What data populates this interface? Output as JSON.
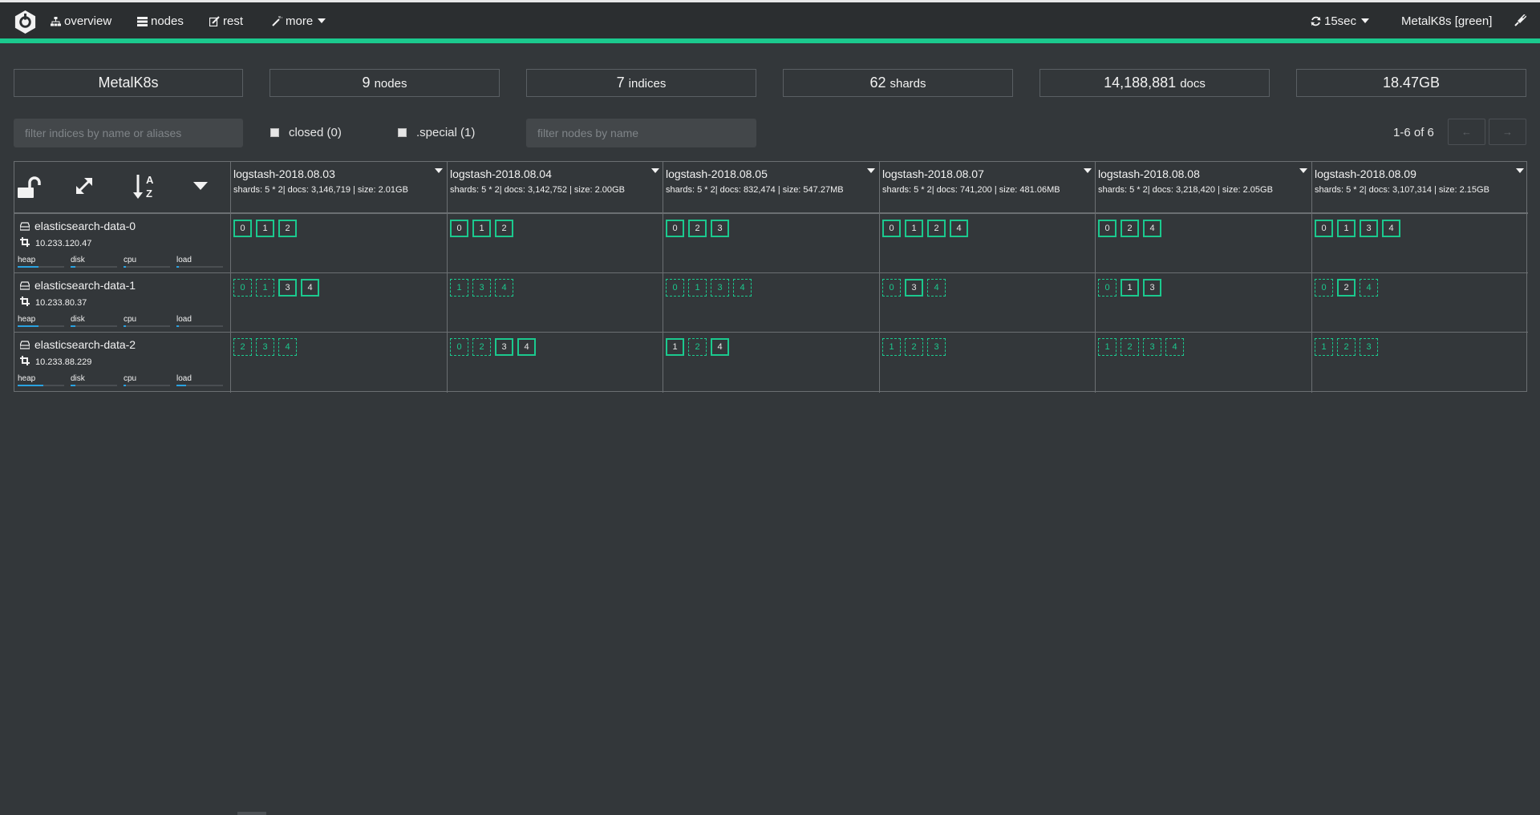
{
  "nav": {
    "overview": "overview",
    "nodes": "nodes",
    "rest": "rest",
    "more": "more",
    "refresh": "15sec",
    "cluster_status": "MetalK8s [green]"
  },
  "colors": {
    "accent": "#1bc98e",
    "metric_bar": "#2aa2e0",
    "background": "#33373a"
  },
  "summary": {
    "cluster_name": "MetalK8s",
    "nodes_count": "9",
    "nodes_unit": "nodes",
    "indices_count": "7",
    "indices_unit": "indices",
    "shards_count": "62",
    "shards_unit": "shards",
    "docs_count": "14,188,881",
    "docs_unit": "docs",
    "size": "18.47GB"
  },
  "filters": {
    "indices_placeholder": "filter indices by name or aliases",
    "closed_label": "closed (0)",
    "special_label": ".special (1)",
    "nodes_placeholder": "filter nodes by name",
    "pagination": "1-6 of 6",
    "prev_label": "←",
    "next_label": "→"
  },
  "toolbar_icons": [
    "unlock-icon",
    "expand-icon",
    "sort-alpha-icon",
    "caret-down-icon"
  ],
  "indices": [
    {
      "name": "logstash-2018.08.03",
      "meta": "shards: 5 * 2| docs: 3,146,719 | size: 2.01GB"
    },
    {
      "name": "logstash-2018.08.04",
      "meta": "shards: 5 * 2| docs: 3,142,752 | size: 2.00GB"
    },
    {
      "name": "logstash-2018.08.05",
      "meta": "shards: 5 * 2| docs: 832,474 | size: 547.27MB"
    },
    {
      "name": "logstash-2018.08.07",
      "meta": "shards: 5 * 2| docs: 741,200 | size: 481.06MB"
    },
    {
      "name": "logstash-2018.08.08",
      "meta": "shards: 5 * 2| docs: 3,218,420 | size: 2.05GB"
    },
    {
      "name": "logstash-2018.08.09",
      "meta": "shards: 5 * 2| docs: 3,107,314 | size: 2.15GB"
    }
  ],
  "nodes": [
    {
      "name": "elasticsearch-data-0",
      "ip": "10.233.120.47",
      "metrics": {
        "heap": "heap",
        "disk": "disk",
        "cpu": "cpu",
        "load": "load"
      },
      "levels": {
        "heap": 0.45,
        "disk": 0.1,
        "cpu": 0.06,
        "load": 0.06
      },
      "shards": [
        [
          {
            "n": "0",
            "p": true
          },
          {
            "n": "1",
            "p": true
          },
          {
            "n": "2",
            "p": true
          }
        ],
        [
          {
            "n": "0",
            "p": true
          },
          {
            "n": "1",
            "p": true
          },
          {
            "n": "2",
            "p": true
          }
        ],
        [
          {
            "n": "0",
            "p": true
          },
          {
            "n": "2",
            "p": true
          },
          {
            "n": "3",
            "p": true
          }
        ],
        [
          {
            "n": "0",
            "p": true
          },
          {
            "n": "1",
            "p": true
          },
          {
            "n": "2",
            "p": true
          },
          {
            "n": "4",
            "p": true
          }
        ],
        [
          {
            "n": "0",
            "p": true
          },
          {
            "n": "2",
            "p": true
          },
          {
            "n": "4",
            "p": true
          }
        ],
        [
          {
            "n": "0",
            "p": true
          },
          {
            "n": "1",
            "p": true
          },
          {
            "n": "3",
            "p": true
          },
          {
            "n": "4",
            "p": true
          }
        ]
      ]
    },
    {
      "name": "elasticsearch-data-1",
      "ip": "10.233.80.37",
      "metrics": {
        "heap": "heap",
        "disk": "disk",
        "cpu": "cpu",
        "load": "load"
      },
      "levels": {
        "heap": 0.45,
        "disk": 0.1,
        "cpu": 0.06,
        "load": 0.06
      },
      "shards": [
        [
          {
            "n": "0",
            "p": false
          },
          {
            "n": "1",
            "p": false
          },
          {
            "n": "3",
            "p": true
          },
          {
            "n": "4",
            "p": true
          }
        ],
        [
          {
            "n": "1",
            "p": false
          },
          {
            "n": "3",
            "p": false
          },
          {
            "n": "4",
            "p": false
          }
        ],
        [
          {
            "n": "0",
            "p": false
          },
          {
            "n": "1",
            "p": false
          },
          {
            "n": "3",
            "p": false
          },
          {
            "n": "4",
            "p": false
          }
        ],
        [
          {
            "n": "0",
            "p": false
          },
          {
            "n": "3",
            "p": true
          },
          {
            "n": "4",
            "p": false
          }
        ],
        [
          {
            "n": "0",
            "p": false
          },
          {
            "n": "1",
            "p": true
          },
          {
            "n": "3",
            "p": true
          }
        ],
        [
          {
            "n": "0",
            "p": false
          },
          {
            "n": "2",
            "p": true
          },
          {
            "n": "4",
            "p": false
          }
        ]
      ]
    },
    {
      "name": "elasticsearch-data-2",
      "ip": "10.233.88.229",
      "metrics": {
        "heap": "heap",
        "disk": "disk",
        "cpu": "cpu",
        "load": "load"
      },
      "levels": {
        "heap": 0.55,
        "disk": 0.1,
        "cpu": 0.06,
        "load": 0.2
      },
      "shards": [
        [
          {
            "n": "2",
            "p": false
          },
          {
            "n": "3",
            "p": false
          },
          {
            "n": "4",
            "p": false
          }
        ],
        [
          {
            "n": "0",
            "p": false
          },
          {
            "n": "2",
            "p": false
          },
          {
            "n": "3",
            "p": true
          },
          {
            "n": "4",
            "p": true
          }
        ],
        [
          {
            "n": "1",
            "p": true
          },
          {
            "n": "2",
            "p": false
          },
          {
            "n": "4",
            "p": true
          }
        ],
        [
          {
            "n": "1",
            "p": false
          },
          {
            "n": "2",
            "p": false
          },
          {
            "n": "3",
            "p": false
          }
        ],
        [
          {
            "n": "1",
            "p": false
          },
          {
            "n": "2",
            "p": false
          },
          {
            "n": "3",
            "p": false
          },
          {
            "n": "4",
            "p": false
          }
        ],
        [
          {
            "n": "1",
            "p": false
          },
          {
            "n": "2",
            "p": false
          },
          {
            "n": "3",
            "p": false
          }
        ]
      ]
    }
  ]
}
